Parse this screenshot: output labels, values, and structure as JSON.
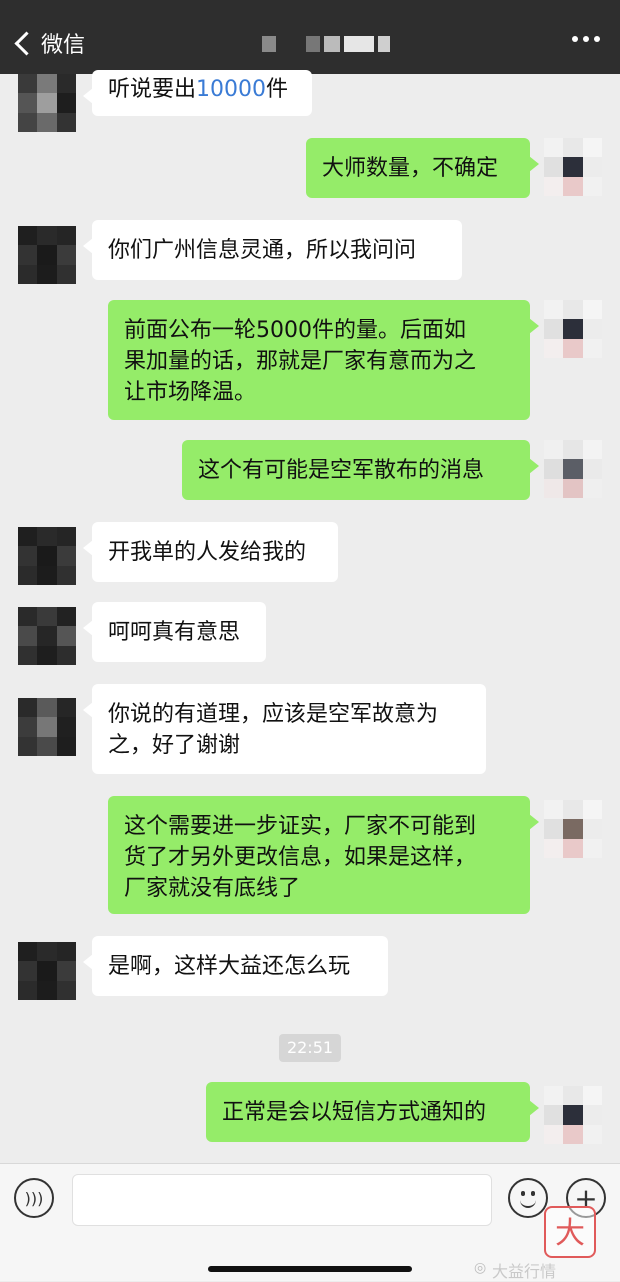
{
  "header": {
    "back_label": "微信",
    "title": "",
    "more": "more-icon"
  },
  "colors": {
    "topbar": "#2e2e2e",
    "chat_bg": "#ededed",
    "bubble_self": "#95ec69",
    "bubble_other": "#ffffff",
    "link": "#3a7bd5"
  },
  "messages": [
    {
      "side": "left",
      "text_a": "听说要出",
      "text_hl": "10000",
      "text_b": "件"
    },
    {
      "side": "right",
      "text": "大师数量，不确定"
    },
    {
      "side": "left",
      "text": "你们广州信息灵通，所以我问问"
    },
    {
      "side": "right",
      "lines": [
        "前面公布一轮5000件的量。后面如",
        "果加量的话，那就是厂家有意而为之",
        "让市场降温。"
      ]
    },
    {
      "side": "right",
      "text": "这个有可能是空军散布的消息"
    },
    {
      "side": "left",
      "text": "开我单的人发给我的"
    },
    {
      "side": "left",
      "text": "呵呵真有意思"
    },
    {
      "side": "left",
      "lines": [
        "你说的有道理，应该是空军故意为",
        "之，好了谢谢"
      ]
    },
    {
      "side": "right",
      "lines": [
        "这个需要进一步证实，厂家不可能到",
        "货了才另外更改信息，如果是这样，",
        "厂家就没有底线了"
      ]
    },
    {
      "side": "left",
      "text": "是啊，这样大益还怎么玩"
    },
    {
      "side": "right",
      "text": "正常是会以短信方式通知的"
    }
  ],
  "timestamp": "22:51",
  "input": {
    "placeholder": ""
  },
  "watermark": {
    "badge": "大",
    "text": "大益行情"
  }
}
